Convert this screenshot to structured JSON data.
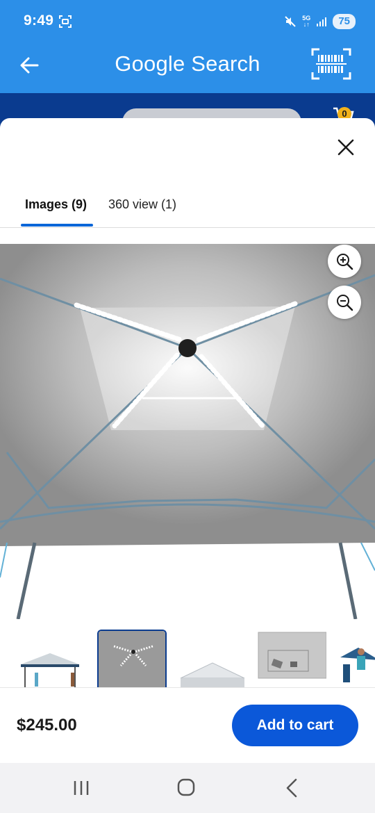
{
  "status_bar": {
    "time": "9:49",
    "network": "5G",
    "battery": "75",
    "icons": [
      "screenshot-icon",
      "mute-icon",
      "signal-icon"
    ]
  },
  "app_bar": {
    "title": "Google Search",
    "back_icon": "arrow-left-icon",
    "barcode_icon": "barcode-scan-icon"
  },
  "background_header": {
    "cart_count": "0"
  },
  "sheet": {
    "close_icon": "close-icon",
    "tabs": [
      {
        "label": "Images (9)",
        "active": true
      },
      {
        "label": "360 view (1)",
        "active": false
      }
    ],
    "zoom_in_icon": "zoom-in-icon",
    "zoom_out_icon": "zoom-out-icon",
    "thumbnails": [
      {
        "name": "canopy-exterior"
      },
      {
        "name": "canopy-lights-interior",
        "selected": true
      },
      {
        "name": "canopy-top"
      },
      {
        "name": "canopy-pocket"
      },
      {
        "name": "canopy-people"
      }
    ]
  },
  "purchase": {
    "price": "$245.00",
    "add_to_cart": "Add to cart"
  },
  "colors": {
    "header_blue": "#2c8fe8",
    "walmart_navy": "#0a3b8f",
    "cta_blue": "#0b58d9",
    "badge_yellow": "#f2b21b"
  },
  "nav_bar": {
    "buttons": [
      "recent-apps-icon",
      "home-icon",
      "back-icon"
    ]
  }
}
